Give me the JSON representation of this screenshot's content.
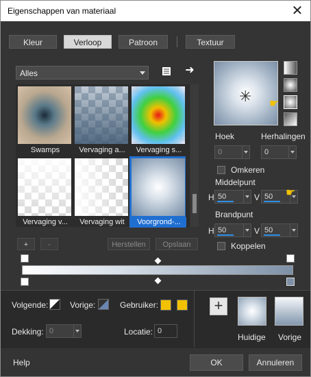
{
  "window": {
    "title": "Eigenschappen van materiaal"
  },
  "tabs": [
    {
      "label": "Kleur"
    },
    {
      "label": "Verloop"
    },
    {
      "label": "Patroon"
    },
    {
      "label": "Textuur"
    }
  ],
  "gallery": {
    "filter": "Alles",
    "items": [
      {
        "label": "Swamps"
      },
      {
        "label": "Vervaging a..."
      },
      {
        "label": "Vervaging s..."
      },
      {
        "label": "Vervaging v..."
      },
      {
        "label": "Vervaging wit"
      },
      {
        "label": "Voorgrond-..."
      }
    ],
    "buttons": {
      "add": "+",
      "remove": "-",
      "reset": "Herstellen",
      "save": "Opslaan"
    }
  },
  "settings": {
    "hoek_label": "Hoek",
    "hoek_value": "0",
    "herhalingen_label": "Herhalingen",
    "herhalingen_value": "0",
    "omkeren_label": "Omkeren",
    "middelpunt_label": "Middelpunt",
    "middelpunt_h": "50",
    "middelpunt_v": "50",
    "brandpunt_label": "Brandpunt",
    "brandpunt_h": "50",
    "brandpunt_v": "50",
    "koppelen_label": "Koppelen",
    "h_label": "H",
    "v_label": "V"
  },
  "bottom": {
    "volgende_label": "Volgende:",
    "vorige_label": "Vorige:",
    "gebruiker_label": "Gebruiker:",
    "dekking_label": "Dekking:",
    "dekking_value": "0",
    "locatie_label": "Locatie:",
    "locatie_value": "0",
    "huidige_label": "Huidige",
    "vorige_preview_label": "Vorige",
    "plus": "+"
  },
  "footer": {
    "help": "Help",
    "ok": "OK",
    "cancel": "Annuleren"
  },
  "colors": {
    "accent": "#1f6fd1",
    "user_swatch": "#f2c200",
    "dialog_bg": "#343434"
  }
}
